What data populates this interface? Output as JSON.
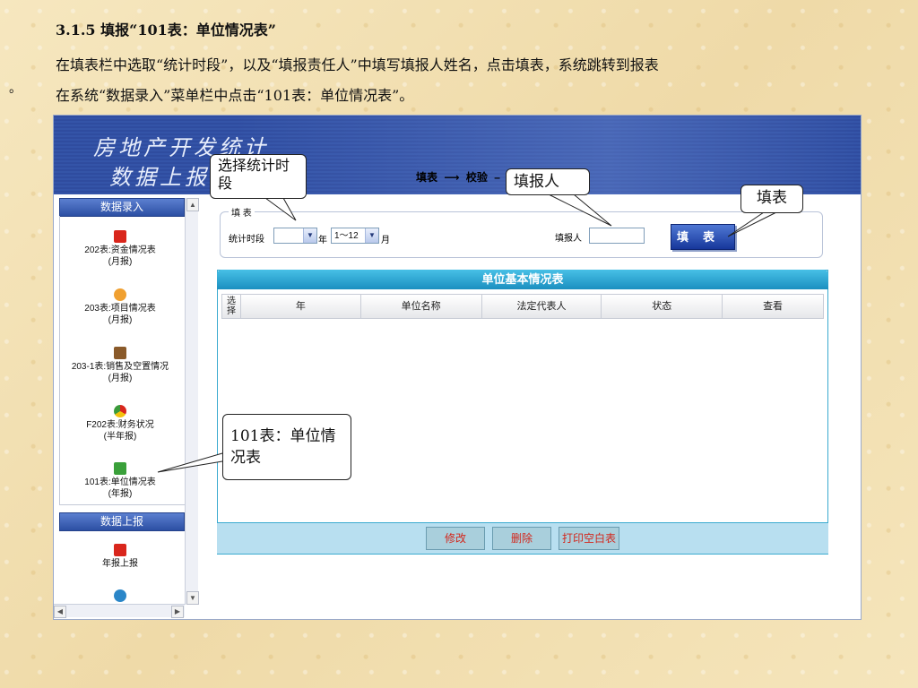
{
  "doc": {
    "heading": "3.1.5 填报“101表：单位情况表”",
    "para1": "在填表栏中选取“统计时段”，以及“填报责任人”中填写填报人姓名，点击填表，系统跳转到报表",
    "para2": "在系统“数据录入”菜单栏中点击“101表：单位情况表”。",
    "stray_mark": "。"
  },
  "app": {
    "title_line1": "房地产开发统计",
    "title_line2": "数据上报",
    "steps": [
      "填表",
      "⟶",
      "校验",
      "–"
    ],
    "sidebar": {
      "section1": "数据录入",
      "items": [
        {
          "label": "202表:资金情况表",
          "sub": "(月报)",
          "icon": "pdf-icon",
          "color": "#d9261c"
        },
        {
          "label": "203表:项目情况表",
          "sub": "(月报)",
          "icon": "orange-globe-icon",
          "color": "#f0a030"
        },
        {
          "label": "203-1表:销售及空置情况",
          "sub": "(月报)",
          "icon": "owl-icon",
          "color": "#8a5a2a"
        },
        {
          "label": "F202表:财务状况",
          "sub": "(半年报)",
          "icon": "chrome-icon",
          "color": "#3a9a3a"
        },
        {
          "label": "101表:单位情况表",
          "sub": "(年报)",
          "icon": "refresh-icon",
          "color": "#3aa03a"
        }
      ],
      "section2": "数据上报",
      "items2": [
        {
          "label": "年报上报",
          "icon": "ie-icon",
          "color": "#d9261c"
        },
        {
          "label": "",
          "icon": "globe-icon",
          "color": "#2a86c8"
        }
      ]
    },
    "fill": {
      "legend": "填 表",
      "period_label": "统计时段",
      "year_value": "",
      "year_suffix": "年",
      "month_value": "1～12",
      "month_suffix": "月",
      "reporter_label": "填报人",
      "reporter_value": "",
      "fill_button": "填表"
    },
    "grid": {
      "title": "单位基本情况表",
      "columns": [
        "选择",
        "年",
        "单位名称",
        "法定代表人",
        "状态",
        "查看"
      ],
      "rows": [],
      "buttons": [
        "修改",
        "删除",
        "打印空白表"
      ]
    }
  },
  "callouts": {
    "period": "选择统计时段",
    "reporter": "填报人",
    "fill": "填表",
    "table101": "101表：单位情况表"
  }
}
